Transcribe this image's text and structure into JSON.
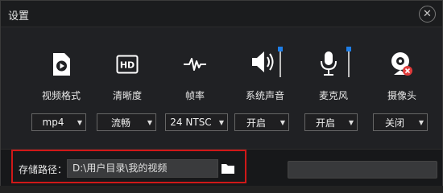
{
  "window": {
    "title": "设置",
    "close_icon": "close-icon"
  },
  "settings": [
    {
      "key": "video-format",
      "icon": "video-file-icon",
      "label": "视频格式",
      "value": "mp4"
    },
    {
      "key": "clarity",
      "icon": "hd-icon",
      "label": "清晰度",
      "value": "流畅"
    },
    {
      "key": "frame-rate",
      "icon": "waveform-icon",
      "label": "帧率",
      "value": "24 NTSC"
    },
    {
      "key": "system-audio",
      "icon": "speaker-icon",
      "label": "系统声音",
      "value": "开启"
    },
    {
      "key": "microphone",
      "icon": "microphone-icon",
      "label": "麦克风",
      "value": "开启"
    },
    {
      "key": "camera",
      "icon": "webcam-icon",
      "label": "摄像头",
      "value": "关闭"
    }
  ],
  "colors": {
    "accent": "#1e7ee8",
    "highlight": "#d01818",
    "camera_disabled_badge": "#e03b3b"
  },
  "footer": {
    "path_label": "存储路径：",
    "path_value": "D:\\用户目录\\我的视频",
    "folder_icon": "folder-icon"
  }
}
